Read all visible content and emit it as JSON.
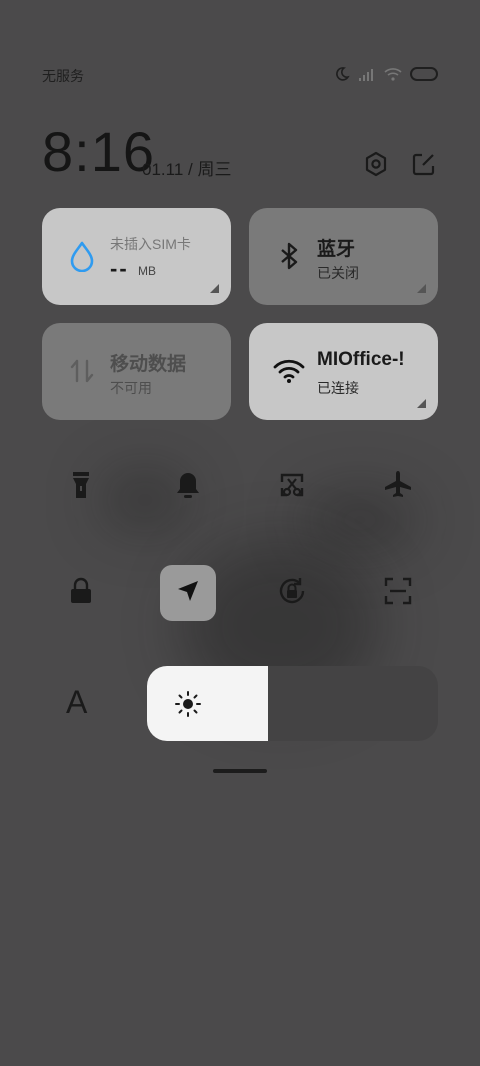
{
  "status_bar": {
    "carrier": "无服务",
    "icons": [
      "moon-icon",
      "signal-icon",
      "wifi-icon",
      "battery-icon"
    ]
  },
  "header": {
    "time": "8:16",
    "date": "01.11 / 周三",
    "icons": [
      "settings-icon",
      "edit-icon"
    ]
  },
  "tiles": [
    {
      "title": "未插入SIM卡",
      "value": "--",
      "unit": "MB",
      "icon": "water-drop-icon"
    },
    {
      "title": "蓝牙",
      "sub": "已关闭",
      "icon": "bluetooth-icon"
    },
    {
      "title": "移动数据",
      "sub": "不可用",
      "icon": "mobile-data-icon"
    },
    {
      "title": "MIOffice-!",
      "sub": "已连接",
      "icon": "wifi-icon"
    }
  ],
  "toggles": [
    "flashlight-icon",
    "bell-icon",
    "screenshot-icon",
    "airplane-icon",
    "lock-icon",
    "location-icon",
    "rotation-lock-icon",
    "scan-icon"
  ],
  "font_label": "A",
  "brightness": {
    "level": 0.41
  },
  "colors": {
    "accent": "#2f9bf0",
    "background": "#4b4a4b"
  }
}
